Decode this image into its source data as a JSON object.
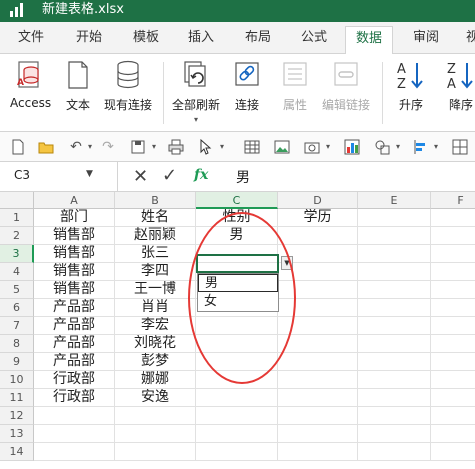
{
  "window": {
    "title": "新建表格.xlsx"
  },
  "menu_tabs": [
    "文件",
    "开始",
    "模板",
    "插入",
    "布局",
    "公式",
    "数据",
    "审阅",
    "视"
  ],
  "active_tab_index": 6,
  "ribbon": {
    "access": "Access",
    "text": "文本",
    "existing_connection": "现有连接",
    "refresh_all": "全部刷新",
    "connection": "连接",
    "properties": "属性",
    "edit_links": "编辑链接",
    "sort_asc": "升序",
    "sort_desc": "降序"
  },
  "formula_bar": {
    "name_box": "C3",
    "fx_label": "fx",
    "content": "男"
  },
  "grid": {
    "columns": [
      "A",
      "B",
      "C",
      "D",
      "E",
      "F"
    ],
    "rows": [
      {
        "n": "1",
        "a": "部门",
        "b": "姓名",
        "c": "性别",
        "d": "学历"
      },
      {
        "n": "2",
        "a": "销售部",
        "b": "赵丽颖",
        "c": "男",
        "d": ""
      },
      {
        "n": "3",
        "a": "销售部",
        "b": "张三",
        "c": "",
        "d": ""
      },
      {
        "n": "4",
        "a": "销售部",
        "b": "李四",
        "c": "",
        "d": ""
      },
      {
        "n": "5",
        "a": "销售部",
        "b": "王一博",
        "c": "",
        "d": ""
      },
      {
        "n": "6",
        "a": "产品部",
        "b": "肖肖",
        "c": "",
        "d": ""
      },
      {
        "n": "7",
        "a": "产品部",
        "b": "李宏",
        "c": "",
        "d": ""
      },
      {
        "n": "8",
        "a": "产品部",
        "b": "刘晓花",
        "c": "",
        "d": ""
      },
      {
        "n": "9",
        "a": "产品部",
        "b": "彭梦",
        "c": "",
        "d": ""
      },
      {
        "n": "10",
        "a": "行政部",
        "b": "娜娜",
        "c": "",
        "d": ""
      },
      {
        "n": "11",
        "a": "行政部",
        "b": "安逸",
        "c": "",
        "d": ""
      },
      {
        "n": "12",
        "a": "",
        "b": "",
        "c": "",
        "d": ""
      },
      {
        "n": "13",
        "a": "",
        "b": "",
        "c": "",
        "d": ""
      },
      {
        "n": "14",
        "a": "",
        "b": "",
        "c": "",
        "d": ""
      }
    ],
    "active_cell": "C3",
    "dropdown_options": [
      "男",
      "女"
    ]
  },
  "colors": {
    "accent": "#1e7145",
    "annotation": "#e53935"
  }
}
